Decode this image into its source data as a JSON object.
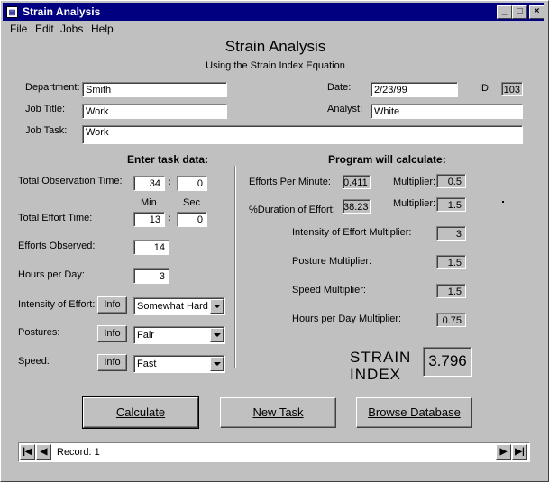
{
  "window": {
    "title": "Strain Analysis",
    "minimize": "_",
    "maximize": "□",
    "close": "×"
  },
  "menu": {
    "file": "File",
    "edit": "Edit",
    "jobs": "Jobs",
    "help": "Help"
  },
  "header": {
    "title": "Strain Analysis",
    "subtitle": "Using the Strain Index Equation"
  },
  "form": {
    "department_label": "Department:",
    "department": "Smith",
    "date_label": "Date:",
    "date": "2/23/99",
    "id_label": "ID:",
    "id": "103",
    "job_title_label": "Job Title:",
    "job_title": "Work",
    "analyst_label": "Analyst:",
    "analyst": "White",
    "job_task_label": "Job Task:",
    "job_task": "Work"
  },
  "task": {
    "heading": "Enter task data:",
    "obs_label": "Total Observation Time:",
    "obs_min": "34",
    "obs_sec": "0",
    "colon": ":",
    "min_label": "Min",
    "sec_label": "Sec",
    "effort_label": "Total Effort Time:",
    "effort_min": "13",
    "effort_sec": "0",
    "efforts_obs_label": "Efforts Observed:",
    "efforts_obs": "14",
    "hours_label": "Hours per Day:",
    "hours": "3",
    "intensity_label": "Intensity of Effort:",
    "intensity": "Somewhat Hard",
    "postures_label": "Postures:",
    "postures": "Fair",
    "speed_label": "Speed:",
    "speed": "Fast",
    "info": "Info"
  },
  "calc": {
    "heading": "Program will calculate:",
    "epm_label": "Efforts Per Minute:",
    "epm": "0.411",
    "mult_label": "Multiplier:",
    "epm_mult": "0.5",
    "dur_label": "%Duration of Effort:",
    "dur": "38.23",
    "dur_mult": "1.5",
    "intensity_mult_label": "Intensity of Effort Multiplier:",
    "intensity_mult": "3",
    "posture_mult_label": "Posture Multiplier:",
    "posture_mult": "1.5",
    "speed_mult_label": "Speed Multiplier:",
    "speed_mult": "1.5",
    "hpd_mult_label": "Hours per Day Multiplier:",
    "hpd_mult": "0.75",
    "strain_label_1": "STRAIN",
    "strain_label_2": "INDEX",
    "strain_index": "3.796"
  },
  "buttons": {
    "calculate": "Calculate",
    "new_task": "New Task",
    "browse": "Browse Database"
  },
  "record": {
    "label": "Record: 1"
  }
}
